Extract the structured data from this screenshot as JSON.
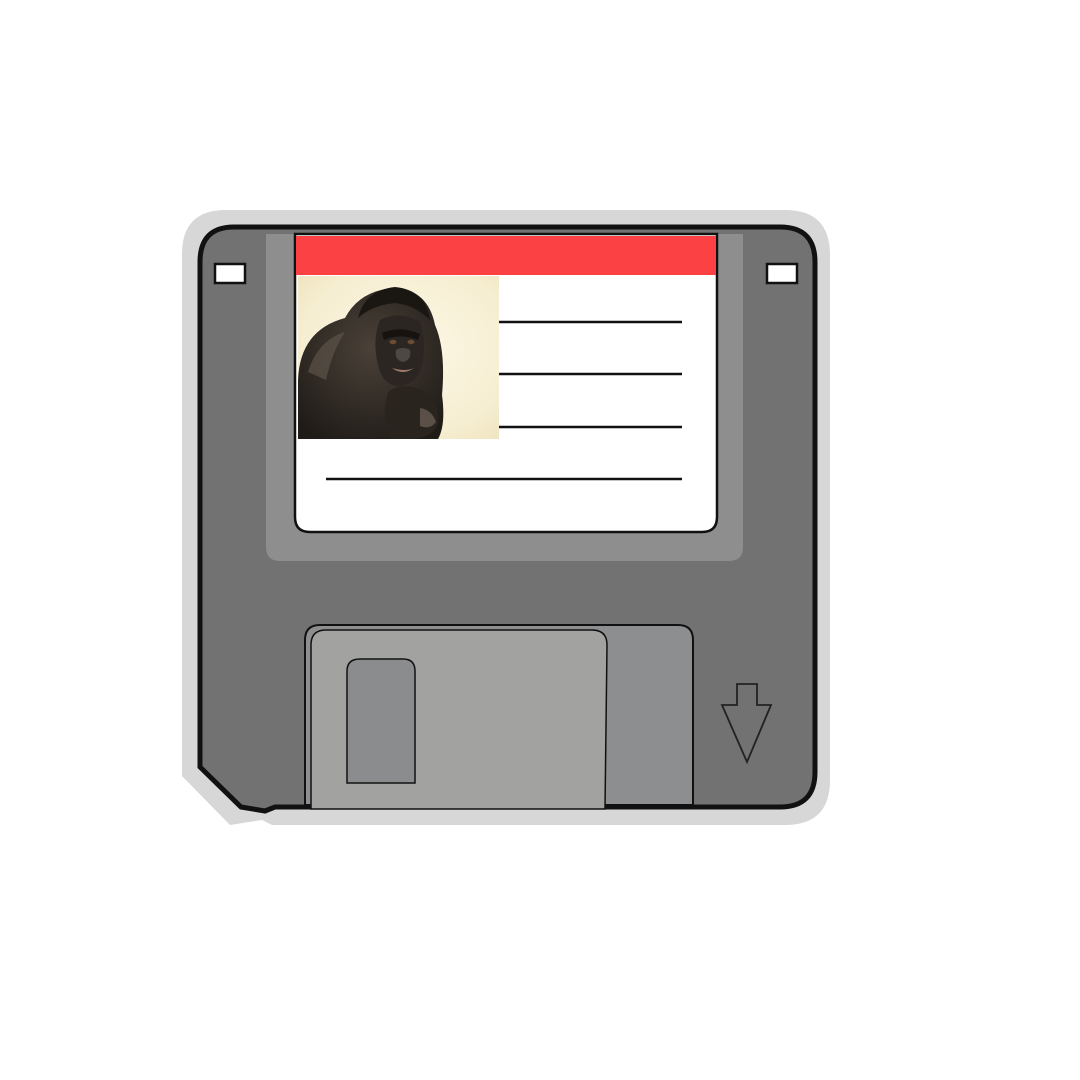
{
  "floppy_disk": {
    "label": {
      "header_color": "#fc4145",
      "writing_lines_count": 4,
      "photo": {
        "subject": "gorilla",
        "icon": "gorilla-photo"
      }
    },
    "colors": {
      "sticker_outline": "#d7d7d7",
      "body": "#717271",
      "body_edge": "#111111",
      "label_recess": "#8e8e8e",
      "label_paper": "#ffffff",
      "shutter": "#a2a3a1",
      "shutter_track": "#8d8e8f",
      "shutter_window": "#8b8c8d",
      "photo_background": "#f8f1d9"
    },
    "icons": {
      "write_protect_left": "write-protect-notch-icon",
      "write_protect_right": "write-protect-notch-icon",
      "insert_direction": "arrow-down-icon"
    }
  }
}
